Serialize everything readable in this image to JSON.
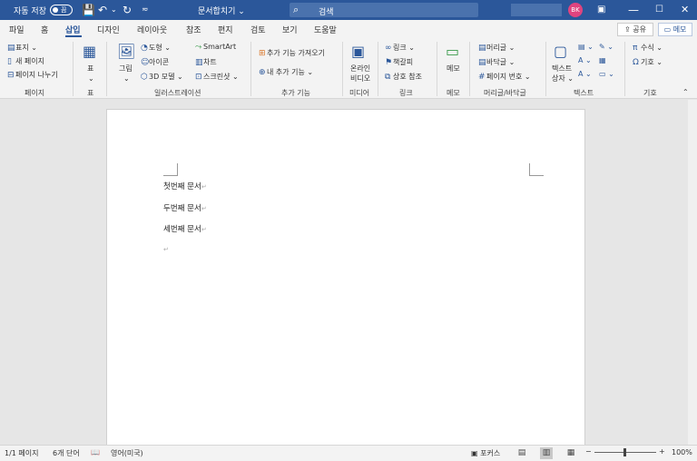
{
  "titlebar": {
    "autosave_label": "자동 저장",
    "autosave_state": "끔",
    "doc_title": "문서합치기 ⌄",
    "search_placeholder": "검색",
    "avatar_initials": "BK"
  },
  "tabs": [
    "파일",
    "홈",
    "삽입",
    "디자인",
    "레이아웃",
    "참조",
    "편지",
    "검토",
    "보기",
    "도움말"
  ],
  "active_tab": "삽입",
  "share_label": "공유",
  "memo_label": "메모",
  "ribbon": {
    "pages": {
      "cover": "표지 ⌄",
      "blank": "새 페이지",
      "break": "페이지 나누기",
      "label": "페이지"
    },
    "table": {
      "btn": "표",
      "label": "표"
    },
    "illustrations": {
      "pictures": "그림",
      "shapes": "도형 ⌄",
      "icons": "아이콘",
      "models3d": "3D 모델 ⌄",
      "smartart": "SmartArt",
      "chart": "차트",
      "screenshot": "스크린샷 ⌄",
      "label": "일러스트레이션"
    },
    "addins": {
      "get": "추가 기능 가져오기",
      "my": "내 추가 기능 ⌄",
      "label": "추가 기능"
    },
    "media": {
      "video1": "온라인",
      "video2": "비디오",
      "label": "미디어"
    },
    "links": {
      "link": "링크 ⌄",
      "bookmark": "책갈피",
      "crossref": "상호 참조",
      "label": "링크"
    },
    "comments": {
      "btn": "메모",
      "label": "메모"
    },
    "headerfooter": {
      "header": "머리글 ⌄",
      "footer": "바닥글 ⌄",
      "pagenum": "페이지 번호 ⌄",
      "label": "머리글/바닥글"
    },
    "text": {
      "textbox1": "텍스트",
      "textbox2": "상자 ⌄",
      "label": "텍스트"
    },
    "symbols": {
      "equation": "수식 ⌄",
      "symbol": "기호 ⌄",
      "label": "기호"
    }
  },
  "document": {
    "paragraphs": [
      "첫번째 문서",
      "두번째 문서",
      "세번째 문서"
    ],
    "para_mark": "↵"
  },
  "status": {
    "page": "1/1 페이지",
    "words": "6개 단어",
    "language": "영어(미국)",
    "focus": "포커스",
    "zoom": "100%",
    "zoom_minus": "−",
    "zoom_plus": "+"
  }
}
